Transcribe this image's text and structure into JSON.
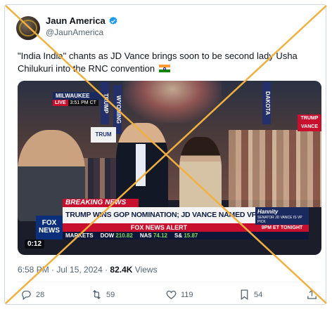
{
  "tweet": {
    "display_name": "Jaun America",
    "handle": "@JaunAmerica",
    "text": "\"India India\" chants as JD Vance brings soon to be second lady Usha Chilukuri into the RNC convention",
    "timestamp": "6:58 PM · Jul 15, 2024 ·",
    "views_count": "82.4K",
    "views_label": "Views",
    "verified_color": "#1d9bf0"
  },
  "video": {
    "location_label": "MILWAUKEE",
    "live_label": "LIVE",
    "live_time": "3:51 PM CT",
    "sign_1": "TRUMP",
    "sign_2": "WYOMING",
    "sign_3": "DAKOTA",
    "trump_sign": "TRUM",
    "trump_sign_2": "TRUMP VANCE",
    "breaking_news": "BREAKING NEWS",
    "headline": "TRUMP WINS GOP NOMINATION; JD VANCE NAMED VP PICK",
    "alert": "FOX NEWS ALERT",
    "network_logo_line1": "FOX",
    "network_logo_line2": "NEWS",
    "hannity_show": "Hannity",
    "hannity_sub": "SENATOR JD VANCE IS VP PICK",
    "hannity_time": "9PM ET TONIGHT",
    "ticker": [
      {
        "label": "MARKETS",
        "value": ""
      },
      {
        "label": "DOW",
        "value": "210.82"
      },
      {
        "label": "NAS",
        "value": "74.12"
      },
      {
        "label": "S&",
        "value": "15.87"
      }
    ],
    "duration": "0:12",
    "brand_red": "#c8102e",
    "brand_navy": "#1a2a5e"
  },
  "actions": {
    "reply_count": "28",
    "retweet_count": "59",
    "like_count": "119",
    "bookmark_count": "54"
  },
  "overlay": {
    "x_mark_color": "#f0b040"
  }
}
